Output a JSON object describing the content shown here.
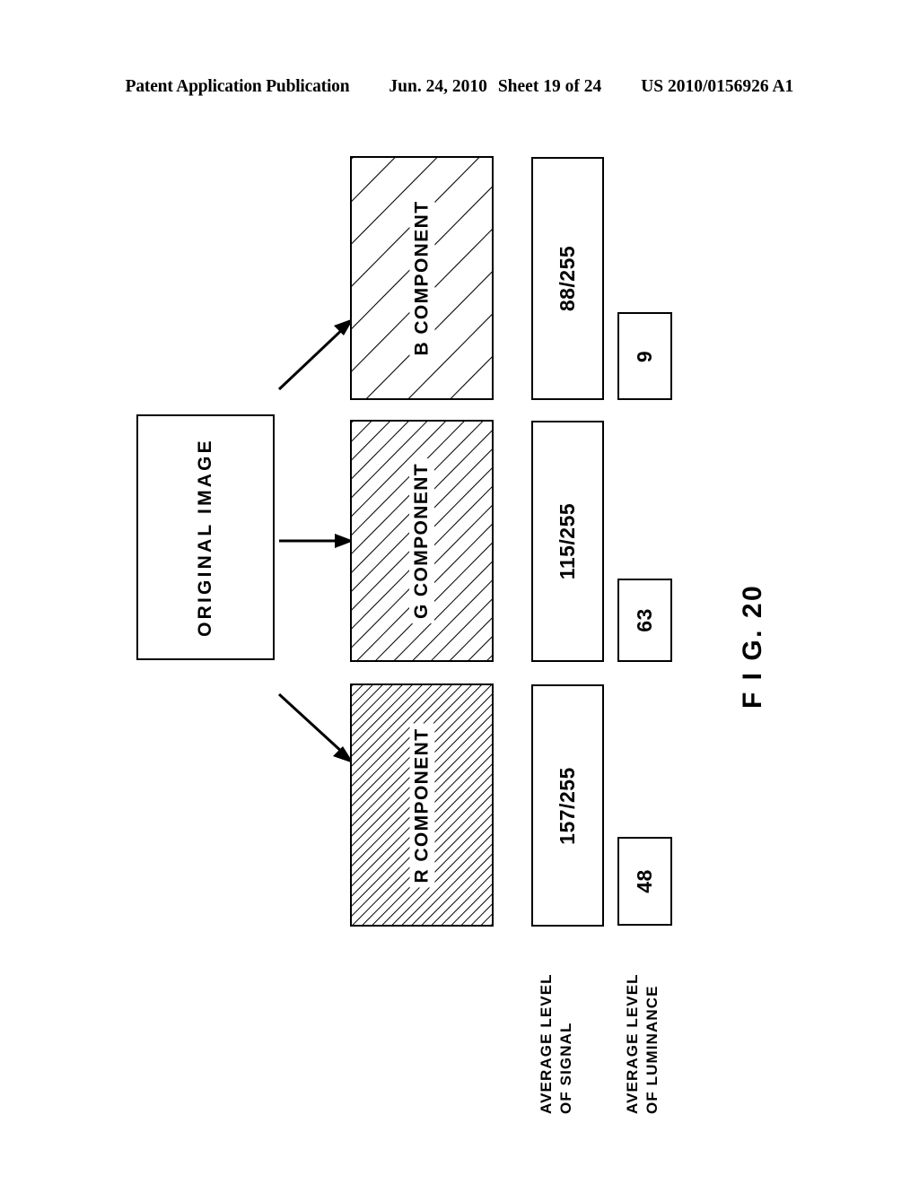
{
  "header": {
    "publication": "Patent Application Publication",
    "date": "Jun. 24, 2010",
    "sheet": "Sheet 19 of 24",
    "patent_number": "US 2010/0156926 A1"
  },
  "figure": {
    "caption": "F I G. 20"
  },
  "source": {
    "label": "ORIGINAL IMAGE"
  },
  "arrows": [
    {
      "name": "arrow-to-b-component",
      "direction": "up-right"
    },
    {
      "name": "arrow-to-g-component",
      "direction": "right"
    },
    {
      "name": "arrow-to-r-component",
      "direction": "down-right"
    }
  ],
  "axis_labels": {
    "signal": "AVERAGE LEVEL\nOF SIGNAL",
    "luminance": "AVERAGE LEVEL\nOF LUMINANCE"
  },
  "rows": [
    {
      "component": "B COMPONENT",
      "hatch_density": "sparse",
      "average_signal": "88/255",
      "average_luminance": "9"
    },
    {
      "component": "G COMPONENT",
      "hatch_density": "medium",
      "average_signal": "115/255",
      "average_luminance": "63"
    },
    {
      "component": "R COMPONENT",
      "hatch_density": "dense",
      "average_signal": "157/255",
      "average_luminance": "48"
    }
  ],
  "colors": {
    "ink": "#000000",
    "paper": "#ffffff"
  }
}
